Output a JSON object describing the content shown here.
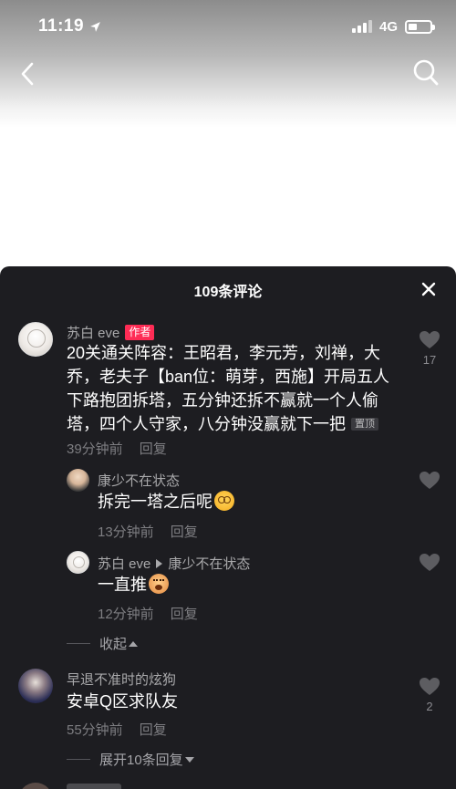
{
  "status": {
    "time": "11:19",
    "network": "4G"
  },
  "icons": {
    "back": "chevron-left-icon",
    "search": "search-icon",
    "close": "close-icon",
    "heart": "heart-icon",
    "location": "location-arrow-icon"
  },
  "colors": {
    "sheet_bg": "#1d1d21",
    "author_badge": "#fe2c55",
    "muted": "#7e7e82"
  },
  "sheet": {
    "title": "109条评论"
  },
  "comments": [
    {
      "author": "苏白 eve",
      "badge": "作者",
      "text": "20关通关阵容：王昭君，李元芳，刘禅，大乔，老夫子【ban位：萌芽，西施】开局五人下路抱团拆塔，五分钟还拆不赢就一个人偷塔，四个人守家，八分钟没赢就下一把",
      "pin": "置顶",
      "time": "39分钟前",
      "reply": "回复",
      "likes": "17",
      "replies": [
        {
          "author": "康少不在状态",
          "text": "拆完一塔之后呢",
          "time": "13分钟前",
          "reply": "回复"
        },
        {
          "author": "苏白 eve",
          "reply_to": "康少不在状态",
          "text": "一直推",
          "time": "12分钟前",
          "reply": "回复"
        }
      ],
      "collapse": "收起"
    },
    {
      "author": "早退不准时的炫狗",
      "text": "安卓Q区求队友",
      "time": "55分钟前",
      "reply": "回复",
      "likes": "2",
      "expand": "展开10条回复"
    }
  ]
}
